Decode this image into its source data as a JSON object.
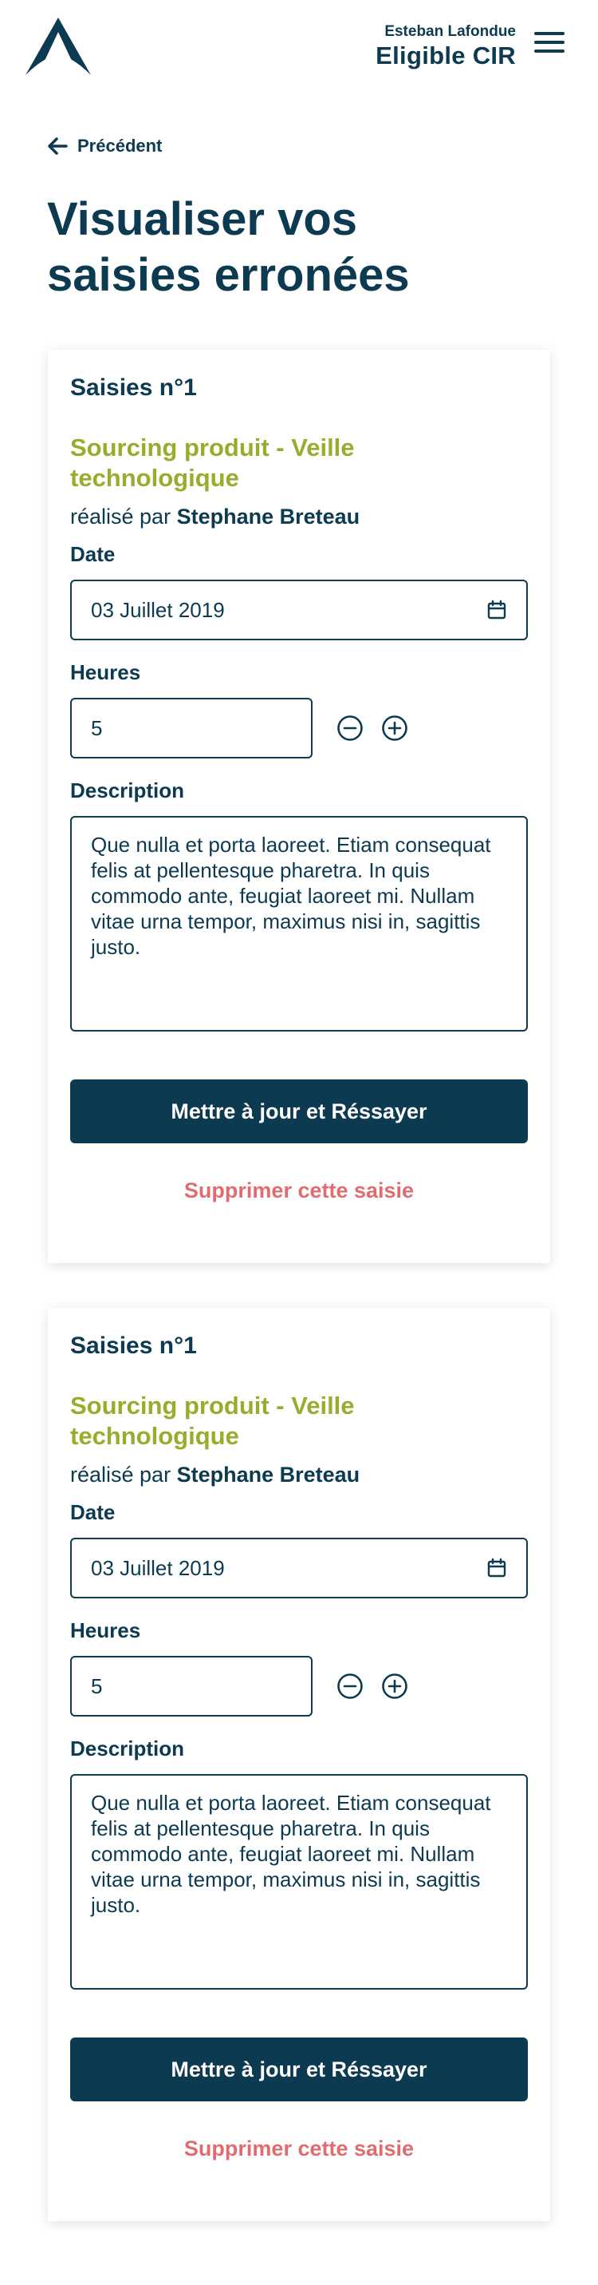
{
  "header": {
    "logo_icon": "triangle-a-logo-icon",
    "user_name": "Esteban Lafondue",
    "user_status": "Eligible CIR",
    "menu_icon": "hamburger-menu-icon"
  },
  "nav": {
    "back_label": "Précédent",
    "back_icon": "arrow-left-icon"
  },
  "page": {
    "title": "Visualiser vos saisies erronées"
  },
  "colors": {
    "primary": "#0b3a51",
    "accent": "#97ad2b",
    "danger": "#e06c70"
  },
  "entries": [
    {
      "title": "Saisies n°1",
      "activity": "Sourcing produit - Veille technologique",
      "byline_prefix": "réalisé par",
      "author": "Stephane Breteau",
      "date_label": "Date",
      "date_value": "03 Juillet 2019",
      "hours_label": "Heures",
      "hours_value": "5",
      "description_label": "Description",
      "description_value": "Que nulla et porta laoreet. Etiam consequat felis at pellentesque pharetra. In quis commodo ante, feugiat laoreet mi. Nullam vitae urna tempor, maximus nisi in, sagittis justo.",
      "update_button": "Mettre à jour et Réssayer",
      "delete_link": "Supprimer cette saisie"
    },
    {
      "title": "Saisies n°1",
      "activity": "Sourcing produit - Veille technologique",
      "byline_prefix": "réalisé par",
      "author": "Stephane Breteau",
      "date_label": "Date",
      "date_value": "03 Juillet 2019",
      "hours_label": "Heures",
      "hours_value": "5",
      "description_label": "Description",
      "description_value": "Que nulla et porta laoreet. Etiam consequat felis at pellentesque pharetra. In quis commodo ante, feugiat laoreet mi. Nullam vitae urna tempor, maximus nisi in, sagittis justo.",
      "update_button": "Mettre à jour et Réssayer",
      "delete_link": "Supprimer cette saisie"
    }
  ]
}
